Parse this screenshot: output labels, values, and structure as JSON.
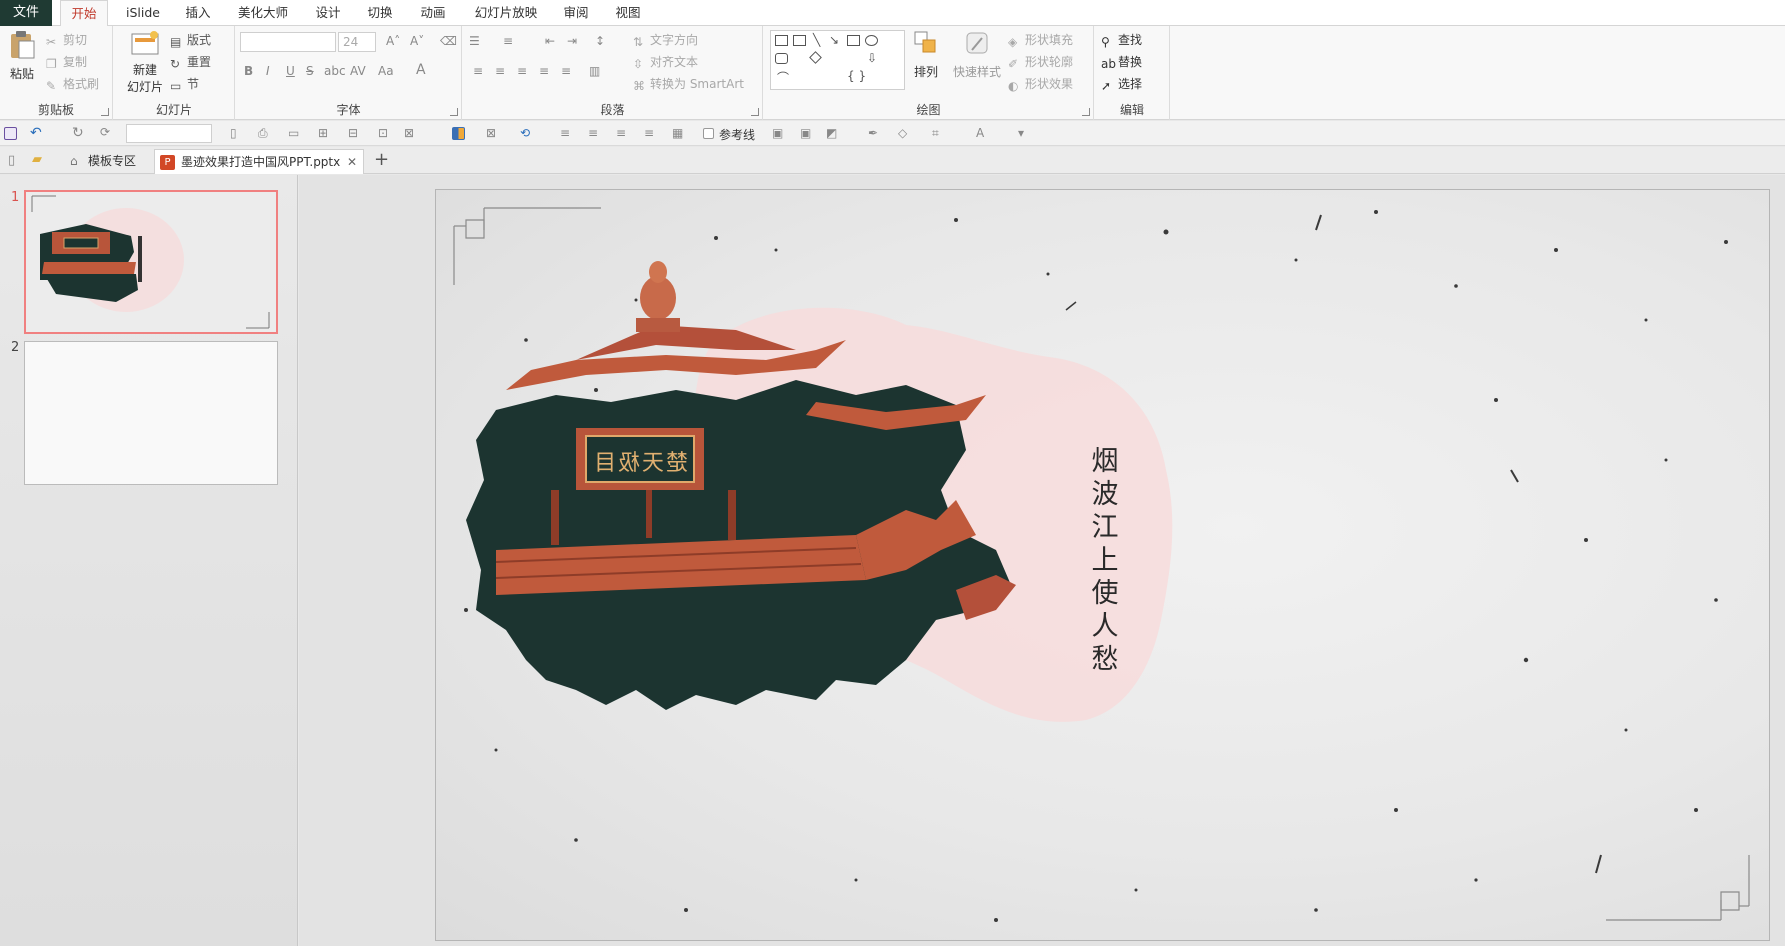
{
  "menu": {
    "file": "文件",
    "tabs": [
      "开始",
      "iSlide",
      "插入",
      "美化大师",
      "设计",
      "切换",
      "动画",
      "幻灯片放映",
      "审阅",
      "视图"
    ],
    "active_tab": "开始"
  },
  "ribbon": {
    "clipboard": {
      "paste": "粘贴",
      "cut": "剪切",
      "copy": "复制",
      "format_painter": "格式刷",
      "label": "剪贴板"
    },
    "slides": {
      "new_slide_line1": "新建",
      "new_slide_line2": "幻灯片",
      "layout": "版式",
      "reset": "重置",
      "section": "节",
      "label": "幻灯片"
    },
    "font": {
      "size": "24",
      "label": "字体"
    },
    "paragraph": {
      "text_direction": "文字方向",
      "align_text": "对齐文本",
      "convert_smartart": "转换为 SmartArt",
      "label": "段落"
    },
    "drawing": {
      "arrange": "排列",
      "quick_styles": "快速样式",
      "shape_fill": "形状填充",
      "shape_outline": "形状轮廓",
      "shape_effects": "形状效果",
      "label": "绘图"
    },
    "editing": {
      "find": "查找",
      "replace": "替换",
      "select": "选择",
      "label": "编辑"
    }
  },
  "qat": {
    "guides": "参考线"
  },
  "doc_tabs": {
    "template_zone": "模板专区",
    "file_name": "墨迹效果打造中国风PPT.pptx",
    "add": "+"
  },
  "slides_pane": {
    "items": [
      {
        "num": "1"
      },
      {
        "num": "2"
      }
    ]
  },
  "slide": {
    "plaque_text": "楚天极目",
    "poem": [
      "烟",
      "波",
      "江",
      "上",
      "使",
      "人",
      "愁"
    ]
  },
  "colors": {
    "file_tab": "#1f3a33",
    "active_tab_text": "#c0392b",
    "selected_thumb_border": "#f08080",
    "roof_dark": "#1c3430",
    "roof_orange": "#c05a3c"
  }
}
